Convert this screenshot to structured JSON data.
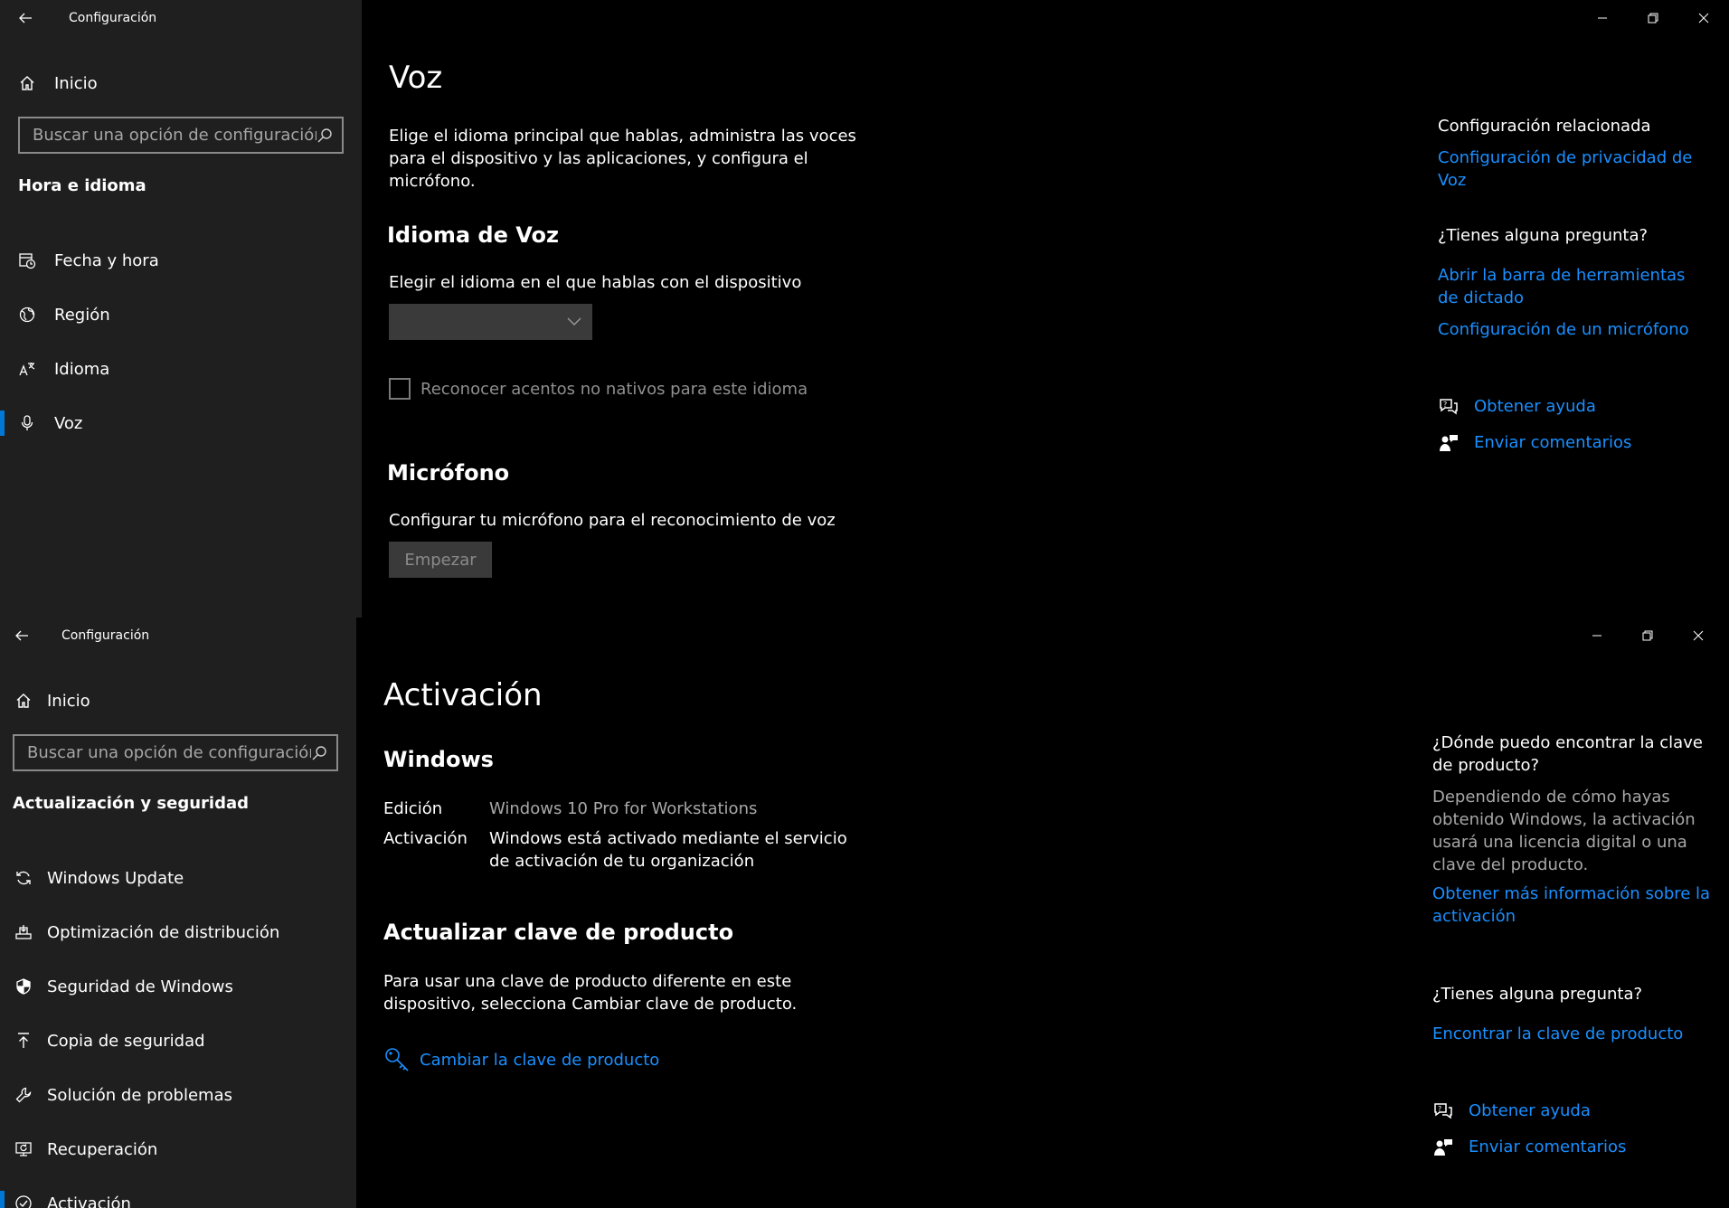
{
  "window1": {
    "app_title": "Configuración",
    "home_label": "Inicio",
    "search_placeholder": "Buscar una opción de configuración",
    "section_title": "Hora e idioma",
    "nav_items": [
      {
        "label": "Fecha y hora",
        "icon": "calendar-clock-icon"
      },
      {
        "label": "Región",
        "icon": "globe-icon"
      },
      {
        "label": "Idioma",
        "icon": "language-icon"
      },
      {
        "label": "Voz",
        "icon": "microphone-icon",
        "selected": true
      }
    ],
    "page_title": "Voz",
    "description": "Elige el idioma principal que hablas, administra las voces para el dispositivo y las aplicaciones, y configura el micrófono.",
    "speech_language_heading": "Idioma de Voz",
    "speech_language_label": "Elegir el idioma en el que hablas con el dispositivo",
    "dropdown_value": "",
    "checkbox_label": "Reconocer acentos no nativos para este idioma",
    "microphone_heading": "Micrófono",
    "microphone_label": "Configurar tu micrófono para el reconocimiento de voz",
    "start_button": "Empezar",
    "related_heading": "Configuración relacionada",
    "related_link": "Configuración de privacidad de Voz",
    "question_heading": "¿Tienes alguna pregunta?",
    "question_links": [
      "Abrir la barra de herramientas de dictado",
      "Configuración de un micrófono"
    ],
    "help_label": "Obtener ayuda",
    "feedback_label": "Enviar comentarios"
  },
  "window2": {
    "app_title": "Configuración",
    "home_label": "Inicio",
    "search_placeholder": "Buscar una opción de configuración",
    "section_title": "Actualización y seguridad",
    "nav_items": [
      {
        "label": "Windows Update",
        "icon": "refresh-icon"
      },
      {
        "label": "Optimización de distribución",
        "icon": "delivery-optimization-icon"
      },
      {
        "label": "Seguridad de Windows",
        "icon": "shield-icon"
      },
      {
        "label": "Copia de seguridad",
        "icon": "backup-arrow-icon"
      },
      {
        "label": "Solución de problemas",
        "icon": "wrench-icon"
      },
      {
        "label": "Recuperación",
        "icon": "recovery-icon"
      },
      {
        "label": "Activación",
        "icon": "check-circle-icon"
      }
    ],
    "page_title": "Activación",
    "windows_heading": "Windows",
    "edition_key": "Edición",
    "edition_value": "Windows 10 Pro for Workstations",
    "activation_key": "Activación",
    "activation_value": "Windows está activado mediante el servicio de activación de tu organización",
    "update_key_heading": "Actualizar clave de producto",
    "update_key_desc": "Para usar una clave de producto diferente en este dispositivo, selecciona Cambiar clave de producto.",
    "change_key_link": "Cambiar la clave de producto",
    "find_key_heading": "¿Dónde puedo encontrar la clave de producto?",
    "find_key_text": "Dependiendo de cómo hayas obtenido Windows, la activación usará una licencia digital o una clave del producto.",
    "more_info_link": "Obtener más información sobre la activación",
    "question_heading": "¿Tienes alguna pregunta?",
    "find_key_link": "Encontrar la clave de producto",
    "help_label": "Obtener ayuda",
    "feedback_label": "Enviar comentarios"
  },
  "colors": {
    "accent": "#0078d7",
    "link": "#1a8fff",
    "sidebar_bg": "#1f1f1f",
    "content_bg": "#000000"
  }
}
